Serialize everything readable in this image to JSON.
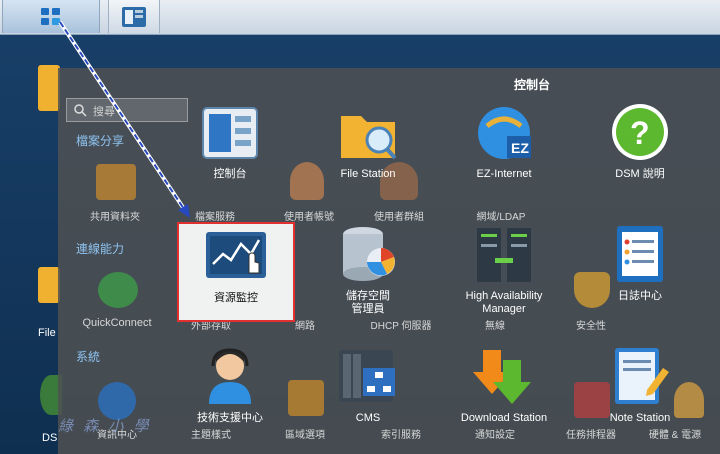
{
  "panel_title": "控制台",
  "search_placeholder": "搜尋",
  "sections": [
    "檔案分享",
    "連線能力",
    "系統"
  ],
  "background_labels": [
    "共用資料夾",
    "檔案服務",
    "使用者帳號",
    "使用者群組",
    "網域/LDAP",
    "QuickConnect",
    "外部存取",
    "網路",
    "DHCP 伺服器",
    "無線",
    "安全性",
    "資訊中心",
    "主題樣式",
    "區域選項",
    "索引服務",
    "通知設定",
    "任務排程器",
    "硬體 & 電源"
  ],
  "apps": [
    {
      "label": "控制台"
    },
    {
      "label": "File Station"
    },
    {
      "label": "EZ-Internet"
    },
    {
      "label": "DSM 說明"
    },
    {
      "label": "資源監控"
    },
    {
      "label": "儲存空間\n管理員"
    },
    {
      "label": "High Availability\nManager"
    },
    {
      "label": "日誌中心"
    },
    {
      "label": "技術支援中心"
    },
    {
      "label": "CMS"
    },
    {
      "label": "Download Station"
    },
    {
      "label": "Note Station"
    }
  ],
  "desktop_labels": [
    "File",
    "DS"
  ],
  "watermark": "綠 森 小 學",
  "colors": {
    "highlight_border": "#e03030",
    "section_text": "#8fc3f0",
    "arrow": "#2848c0"
  }
}
